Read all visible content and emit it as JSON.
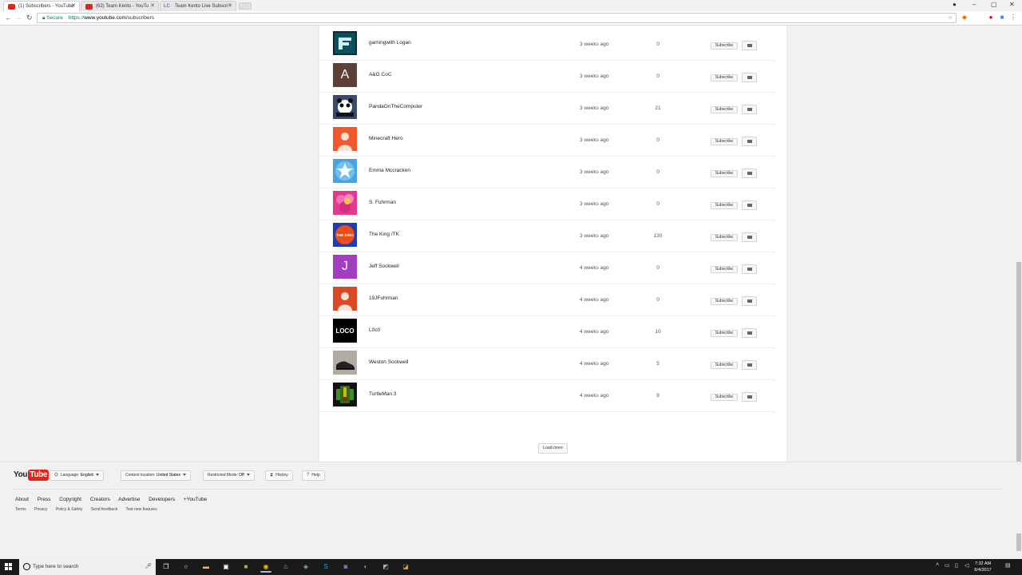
{
  "browser": {
    "tabs": [
      {
        "title": "(1) Subscribers - YouTube",
        "icon": "youtube-icon",
        "active": true
      },
      {
        "title": "(62) Team Kento - YouTu",
        "icon": "youtube-icon",
        "active": false
      },
      {
        "title": "Team Kento Live Subscri",
        "icon": "lc-icon",
        "favicon_text": "LC",
        "active": false
      }
    ],
    "secure_label": "Secure",
    "url_scheme": "https://",
    "url_host": "www.youtube.com",
    "url_path": "/subscribers"
  },
  "subscribers": [
    {
      "name": "gamingwith Logan",
      "time": "3 weeks ago",
      "count": "0",
      "avatar": "faze-logo",
      "color": "#0f9fb0"
    },
    {
      "name": "A&G CoC",
      "time": "3 weeks ago",
      "count": "0",
      "avatar": "letter",
      "letter": "A",
      "color": "#5d4037"
    },
    {
      "name": "PandaOnTheComputer",
      "time": "3 weeks ago",
      "count": "21",
      "avatar": "panda",
      "color": "#3a4a6a"
    },
    {
      "name": "Minecraft Hero",
      "time": "3 weeks ago",
      "count": "0",
      "avatar": "default-person",
      "color": "#ef5b2d"
    },
    {
      "name": "Emma Mccracken",
      "time": "3 weeks ago",
      "count": "0",
      "avatar": "star",
      "color": "#4aa3df"
    },
    {
      "name": "S. Fuhrman",
      "time": "3 weeks ago",
      "count": "0",
      "avatar": "flower",
      "color": "#e03a8c"
    },
    {
      "name": "The King /TK",
      "time": "3 weeks ago",
      "count": "130",
      "avatar": "the-king",
      "color": "#1e3fae",
      "badge_text": "THE KING"
    },
    {
      "name": "Jeff Sockwell",
      "time": "4 weeks ago",
      "count": "0",
      "avatar": "letter",
      "letter": "J",
      "color": "#a23dbf"
    },
    {
      "name": "19JFuhrman",
      "time": "4 weeks ago",
      "count": "0",
      "avatar": "default-person",
      "color": "#d84a26"
    },
    {
      "name": "L0c0",
      "time": "4 weeks ago",
      "count": "10",
      "avatar": "loco",
      "color": "#000000",
      "badge_text": "LOCO"
    },
    {
      "name": "Weston Sockwell",
      "time": "4 weeks ago",
      "count": "5",
      "avatar": "shoe",
      "color": "#b0aba3"
    },
    {
      "name": "TurtleMan 3",
      "time": "4 weeks ago",
      "count": "9",
      "avatar": "pixel-turtle",
      "color": "#2e6b1a"
    }
  ],
  "subscribe_label": "Subscribe",
  "load_more_label": "Load more",
  "footer": {
    "logo_you": "You",
    "logo_tube": "Tube",
    "language_label": "Language:",
    "language_value": "English",
    "location_label": "Content location:",
    "location_value": "United States",
    "restricted_label": "Restricted Mode:",
    "restricted_value": "Off",
    "history_label": "History",
    "help_label": "Help",
    "primary_links": [
      "About",
      "Press",
      "Copyright",
      "Creators",
      "Advertise",
      "Developers",
      "+YouTube"
    ],
    "secondary_links": [
      "Terms",
      "Privacy",
      "Policy & Safety",
      "Send feedback",
      "Test new features"
    ]
  },
  "taskbar": {
    "search_placeholder": "Type here to search",
    "time": "7:32 AM",
    "date": "8/4/2017"
  },
  "colors": {
    "youtube_red": "#e62117",
    "page_bg": "#f1f1f1",
    "card_bg": "#ffffff",
    "taskbar_bg": "#1a1a1a"
  }
}
